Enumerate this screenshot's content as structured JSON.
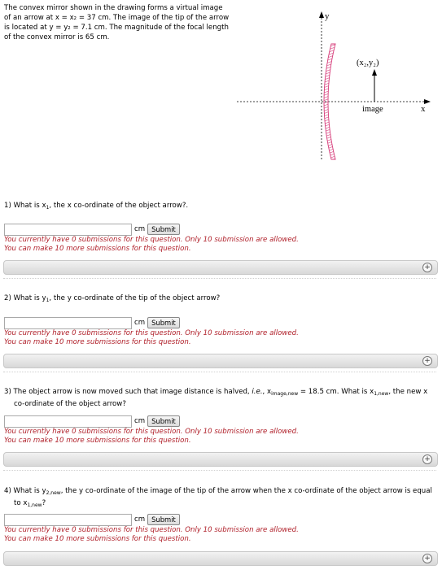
{
  "problem": {
    "intro_lines": [
      "The convex mirror shown in the drawing forms a virtual image",
      "of an arrow at x = x₂ = 37 cm. The image of the tip of the arrow",
      "is located at y = y₂ = 7.1 cm. The magnitude of the focal length",
      "of the convex mirror is 65 cm."
    ],
    "figure": {
      "y_axis_label": "y",
      "x_axis_label": "x",
      "point_label": "(x₂,y₂)",
      "image_label": "image",
      "mirror_color": "#d63c7a"
    }
  },
  "questions": [
    {
      "number": "1)",
      "text_lines": [
        "What is x₁, the x co-ordinate of the object arrow?."
      ],
      "unit": "cm",
      "submit_label": "Submit",
      "status_lines": [
        "You currently have 0 submissions for this question. Only 10 submission are allowed.",
        "You can make 10 more submissions for this question."
      ]
    },
    {
      "number": "2)",
      "text_lines": [
        "What is y₁, the y co-ordinate of the tip of the object arrow?"
      ],
      "unit": "cm",
      "submit_label": "Submit",
      "status_lines": [
        "You currently have 0 submissions for this question. Only 10 submission are allowed.",
        "You can make 10 more submissions for this question."
      ]
    },
    {
      "number": "3)",
      "text_lines": [
        "The object arrow is now moved such that image distance is halved, i.e., ximage,new = 18.5 cm. What is x1,new, the new x",
        "co-ordinate of the object arrow?"
      ],
      "unit": "cm",
      "submit_label": "Submit",
      "status_lines": [
        "You currently have 0 submissions for this question. Only 10 submission are allowed.",
        "You can make 10 more submissions for this question."
      ]
    },
    {
      "number": "4)",
      "text_lines": [
        "What is y2,new, the y co-ordinate of the image of the tip of the arrow when the x co-ordinate of the object arrow is",
        "equal to x1,new?"
      ],
      "unit": "cm",
      "submit_label": "Submit",
      "status_lines": [
        "You currently have 0 submissions for this question. Only 10 submission are allowed.",
        "You can make 10 more submissions for this question."
      ]
    }
  ],
  "hint_toggle_icon": "plus-circle-icon",
  "hint_toggle_glyph": "+"
}
